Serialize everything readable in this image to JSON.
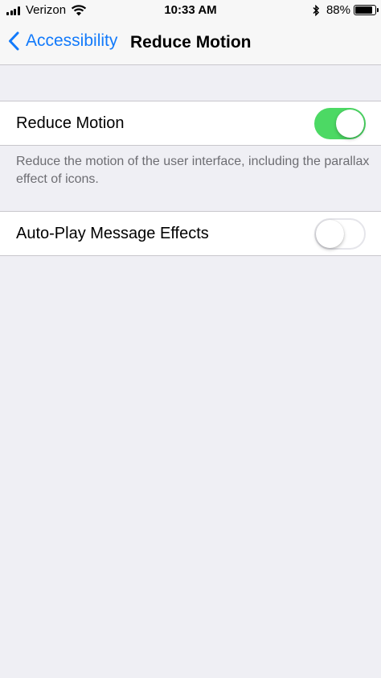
{
  "status_bar": {
    "carrier": "Verizon",
    "time": "10:33 AM",
    "battery_percent": "88%",
    "battery_level": 0.88,
    "icons": [
      "signal-icon",
      "wifi-icon",
      "bluetooth-icon",
      "battery-icon"
    ]
  },
  "nav": {
    "back_label": "Accessibility",
    "title": "Reduce Motion"
  },
  "settings": {
    "reduce_motion": {
      "label": "Reduce Motion",
      "enabled": true
    },
    "reduce_motion_footer": "Reduce the motion of the user interface, including the parallax effect of icons.",
    "auto_play": {
      "label": "Auto-Play Message Effects",
      "enabled": false
    }
  },
  "colors": {
    "accent": "#127afb",
    "toggle_on": "#4cd964",
    "background": "#efeff4"
  }
}
